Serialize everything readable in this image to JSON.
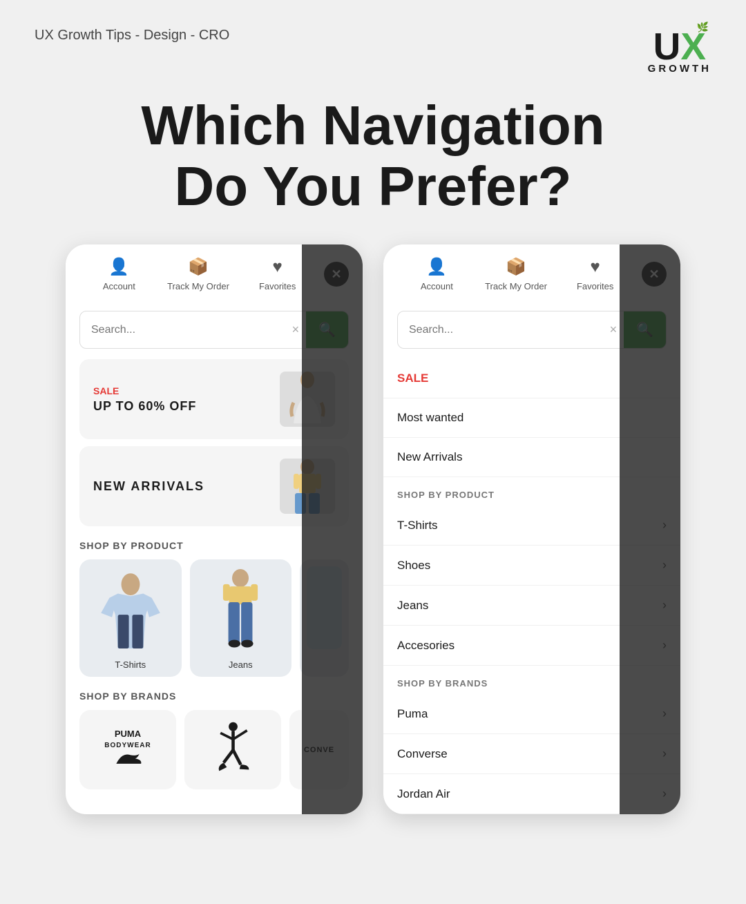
{
  "header": {
    "tagline": "UX Growth Tips - Design - CRO",
    "logo_u": "UX",
    "logo_growth": "GROWTH"
  },
  "main_heading": {
    "line1": "Which Navigation",
    "line2": "Do You Prefer?"
  },
  "phone1": {
    "nav": {
      "account_label": "Account",
      "track_label": "Track My Order",
      "favorites_label": "Favorites"
    },
    "search": {
      "placeholder": "Search...",
      "clear_label": "×"
    },
    "promo": {
      "sale_label": "SALE",
      "sale_text": "UP TO 60% OFF",
      "new_label": "NEW ARRIVALS"
    },
    "shop_by_product_header": "SHOP BY PRODUCT",
    "products": [
      {
        "label": "T-Shirts"
      },
      {
        "label": "Jeans"
      }
    ],
    "shop_by_brands_header": "SHOP BY BRANDS",
    "brands": [
      "PUMA BODYWEAR",
      "Jordan",
      "CONVERSE"
    ]
  },
  "phone2": {
    "nav": {
      "account_label": "Account",
      "track_label": "Track My Order",
      "favorites_label": "Favorites"
    },
    "search": {
      "placeholder": "Search...",
      "clear_label": "×"
    },
    "list_items": [
      {
        "text": "SALE",
        "red": true,
        "chevron": false
      },
      {
        "text": "Most wanted",
        "red": false,
        "chevron": false
      },
      {
        "text": "New Arrivals",
        "red": false,
        "chevron": false
      }
    ],
    "shop_by_product_header": "SHOP BY PRODUCT",
    "product_items": [
      {
        "text": "T-Shirts",
        "chevron": true
      },
      {
        "text": "Shoes",
        "chevron": true
      },
      {
        "text": "Jeans",
        "chevron": true
      },
      {
        "text": "Accesories",
        "chevron": true
      }
    ],
    "shop_by_brands_header": "SHOP BY BRANDS",
    "brand_items": [
      {
        "text": "Puma",
        "chevron": true
      },
      {
        "text": "Converse",
        "chevron": true
      },
      {
        "text": "Jordan Air",
        "chevron": true
      }
    ]
  },
  "colors": {
    "green": "#4caf50",
    "red": "#e53935",
    "dark": "#1a1a1a",
    "gray": "#555555"
  }
}
